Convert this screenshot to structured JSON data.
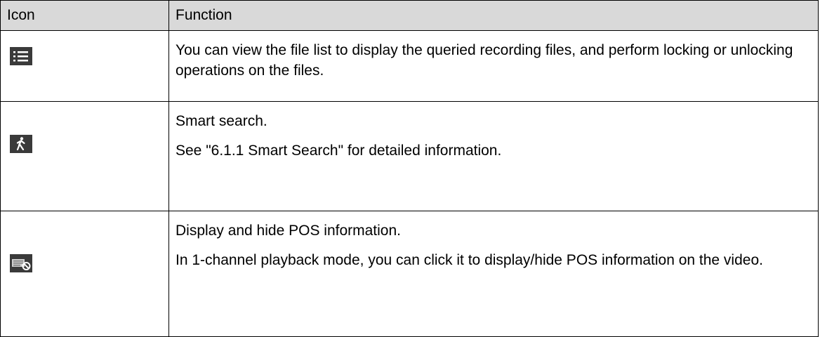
{
  "table": {
    "headers": {
      "icon": "Icon",
      "function": "Function"
    },
    "rows": [
      {
        "icon": "list-icon",
        "paragraphs": [
          "You can view the file list to display the queried recording files, and perform locking or unlocking operations on the files."
        ]
      },
      {
        "icon": "smart-search-walking-person-icon",
        "paragraphs": [
          "Smart search.",
          "See \"6.1.1 Smart Search\" for detailed information."
        ]
      },
      {
        "icon": "pos-hide-icon",
        "paragraphs": [
          "Display and hide POS information.",
          "In 1-channel playback mode, you can click it to display/hide POS information on the video."
        ]
      }
    ]
  },
  "colors": {
    "header_bg": "#d9d9d9",
    "icon_bg": "#3a3a3a",
    "border": "#000000"
  }
}
